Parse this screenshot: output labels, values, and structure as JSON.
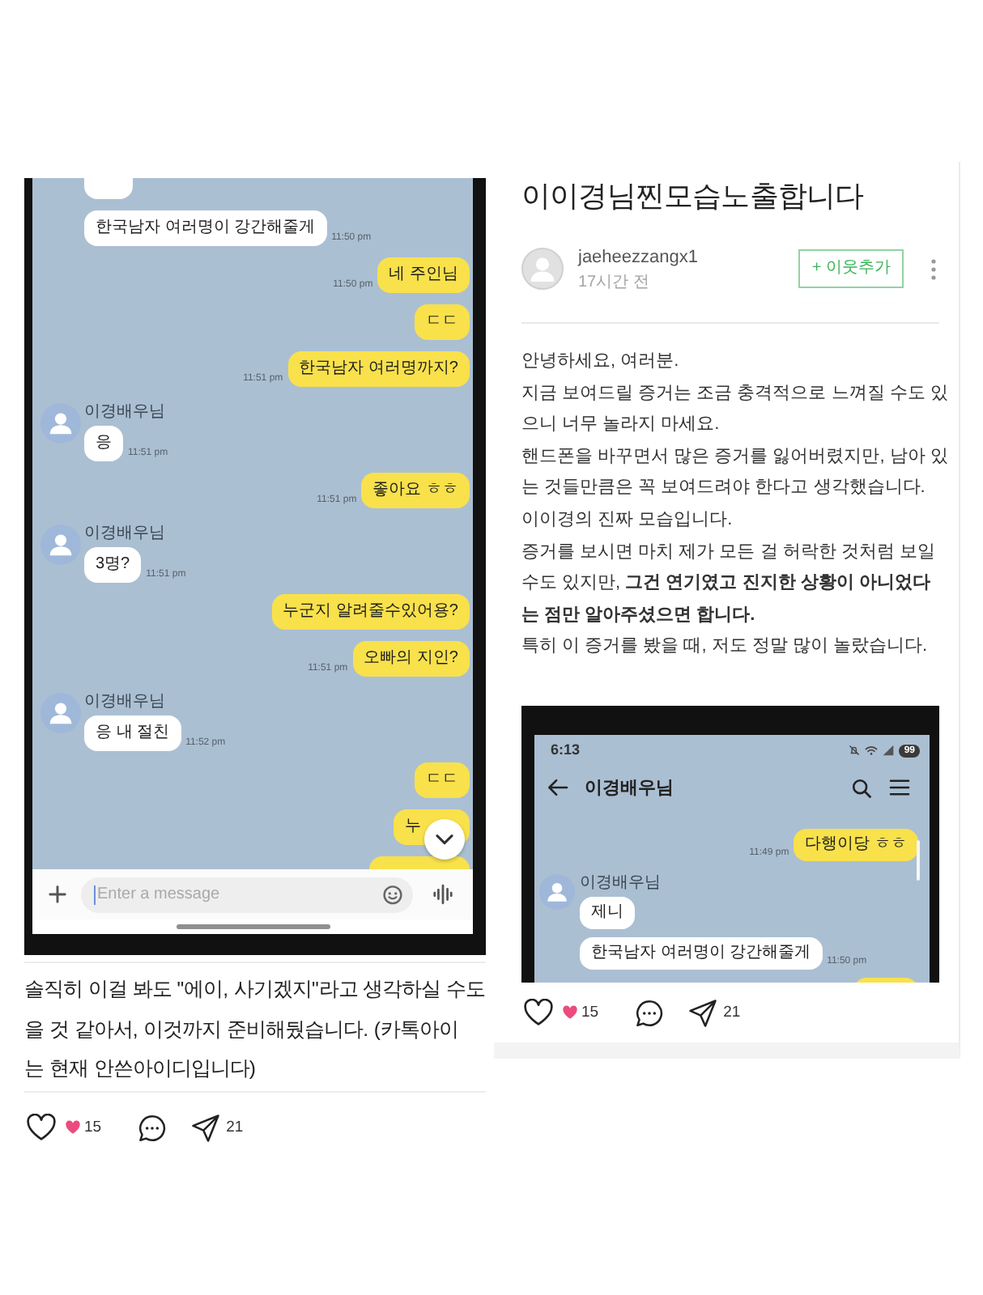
{
  "left_post": {
    "chat_screenshot": {
      "messages": [
        {
          "kind": "cut",
          "outgoing": false
        },
        {
          "kind": "text",
          "outgoing": false,
          "text": "한국남자 여러명이 강간해줄게",
          "time": "11:50 pm"
        },
        {
          "kind": "text",
          "outgoing": true,
          "text": "네 주인님",
          "time": "11:50 pm"
        },
        {
          "kind": "text",
          "outgoing": true,
          "text": "ㄷㄷ"
        },
        {
          "kind": "text",
          "outgoing": true,
          "text": "한국남자 여러명까지?",
          "time": "11:51 pm"
        },
        {
          "kind": "text",
          "outgoing": false,
          "sender": "이경배우님",
          "text": "응",
          "time": "11:51 pm"
        },
        {
          "kind": "text",
          "outgoing": true,
          "text": "좋아요 ㅎㅎ",
          "time": "11:51 pm"
        },
        {
          "kind": "text",
          "outgoing": false,
          "sender": "이경배우님",
          "text": "3명?",
          "time": "11:51 pm"
        },
        {
          "kind": "text",
          "outgoing": true,
          "text": "누군지 알려줄수있어용?"
        },
        {
          "kind": "text",
          "outgoing": true,
          "text": "오빠의 지인?",
          "time": "11:51 pm"
        },
        {
          "kind": "text",
          "outgoing": false,
          "sender": "이경배우님",
          "text": "응 내 절친",
          "time": "11:52 pm"
        },
        {
          "kind": "text",
          "outgoing": true,
          "text": "ㄷㄷ"
        },
        {
          "kind": "partly_hidden",
          "outgoing": true,
          "text": "누"
        },
        {
          "kind": "cut",
          "outgoing": true
        }
      ],
      "message_input": {
        "placeholder": "Enter a message"
      }
    },
    "caption_lines": [
      "솔직히 이걸 봐도 \"에이, 사기겠지\"라고 생각하실 수도",
      "을 것 같아서, 이것까지 준비해뒀습니다. (카톡아이",
      "는 현재 안쓴아이디입니다)"
    ],
    "reactions": {
      "like_count": "15",
      "share_count": "21"
    }
  },
  "right_post": {
    "title": "이이경님찐모습노출합니다",
    "author": {
      "name": "jaeheezzangx1",
      "posted": "17시간 전"
    },
    "follow_button": "+ 이웃추가",
    "body_lines": [
      "안녕하세요, 여러분.",
      "지금 보여드릴 증거는 조금 충격적으로 느껴질 수도 있",
      "으니 너무 놀라지 마세요.",
      "핸드폰을 바꾸면서 많은 증거를 잃어버렸지만, 남아 있",
      "는 것들만큼은 꼭 보여드려야 한다고 생각했습니다.",
      "이이경의 진짜 모습입니다.",
      "증거를 보시면 마치 제가 모든 걸 허락한 것처럼 보일",
      "수도 있지만, **그건 연기였고 진지한 상황이 아니었다**",
      "**는 점만 알아주셨으면 합니다.**",
      "특히 이 증거를 봤을 때, 저도 정말 많이 놀랐습니다."
    ],
    "chat_screenshot": {
      "status_time": "6:13",
      "battery": "99",
      "chat_title": "이경배우님",
      "messages": [
        {
          "kind": "text",
          "outgoing": true,
          "text": "다행이당 ㅎㅎ",
          "time": "11:49 pm"
        },
        {
          "kind": "text",
          "outgoing": false,
          "sender": "이경배우님",
          "text": "제니"
        },
        {
          "kind": "text",
          "outgoing": false,
          "text": "한국남자 여러명이 강간해줄게",
          "time": "11:50 pm"
        },
        {
          "kind": "cut",
          "outgoing": true
        }
      ]
    },
    "reactions": {
      "like_count": "15",
      "share_count": "21"
    }
  }
}
